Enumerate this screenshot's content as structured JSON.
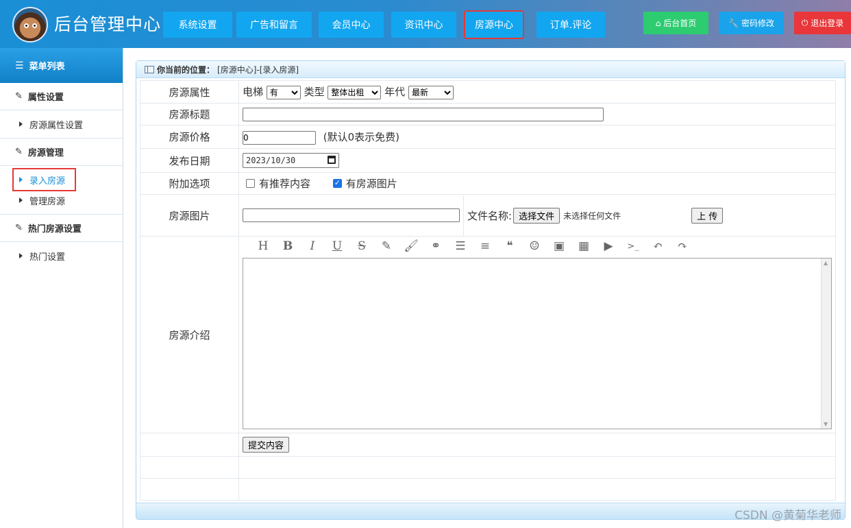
{
  "header": {
    "title": "后台管理中心",
    "nav": [
      {
        "label": "系统设置"
      },
      {
        "label": "广告和留言"
      },
      {
        "label": "会员中心"
      },
      {
        "label": "资讯中心"
      },
      {
        "label": "房源中心",
        "highlighted": true
      },
      {
        "label": "订单.评论"
      }
    ],
    "actions": {
      "home": "后台首页",
      "password": "密码修改",
      "logout": "退出登录"
    },
    "colors": {
      "nav": "#12a6f0",
      "home": "#2ecc71",
      "password": "#1aa3ea",
      "logout": "#e8363a"
    }
  },
  "sidebar": {
    "title": "菜单列表",
    "groups": [
      {
        "label": "属性设置",
        "items": [
          {
            "label": "房源属性设置"
          }
        ]
      },
      {
        "label": "房源管理",
        "items": [
          {
            "label": "录入房源",
            "active": true
          },
          {
            "label": "管理房源"
          }
        ]
      },
      {
        "label": "热门房源设置",
        "items": [
          {
            "label": "热门设置"
          }
        ]
      }
    ]
  },
  "breadcrumb": {
    "prefix": "你当前的位置：",
    "path": "[房源中心]-[录入房源]"
  },
  "form": {
    "attr": {
      "label": "房源属性",
      "elevator_label": "电梯",
      "elevator_value": "有",
      "type_label": "类型",
      "type_value": "整体出租",
      "year_label": "年代",
      "year_value": "最新"
    },
    "title": {
      "label": "房源标题",
      "value": ""
    },
    "price": {
      "label": "房源价格",
      "value": "0",
      "hint": "(默认0表示免费)"
    },
    "date": {
      "label": "发布日期",
      "value": "2023/10/30"
    },
    "options": {
      "label": "附加选项",
      "recommend": "有推荐内容",
      "recommend_checked": false,
      "image": "有房源图片",
      "image_checked": true
    },
    "image": {
      "label": "房源图片",
      "value": "",
      "file_label": "文件名称:",
      "choose": "选择文件",
      "no_file": "未选择任何文件",
      "upload": "上 传"
    },
    "intro": {
      "label": "房源介绍",
      "toolbar": [
        "heading-icon",
        "bold-icon",
        "italic-icon",
        "underline-icon",
        "strikethrough-icon",
        "pen-icon",
        "brush-icon",
        "link-icon",
        "list-icon",
        "align-icon",
        "quote-icon",
        "emoji-icon",
        "image-icon",
        "table-icon",
        "video-icon",
        "code-icon",
        "undo-icon",
        "redo-icon"
      ]
    },
    "submit": "提交内容"
  },
  "watermark": "CSDN @黄菊华老师"
}
